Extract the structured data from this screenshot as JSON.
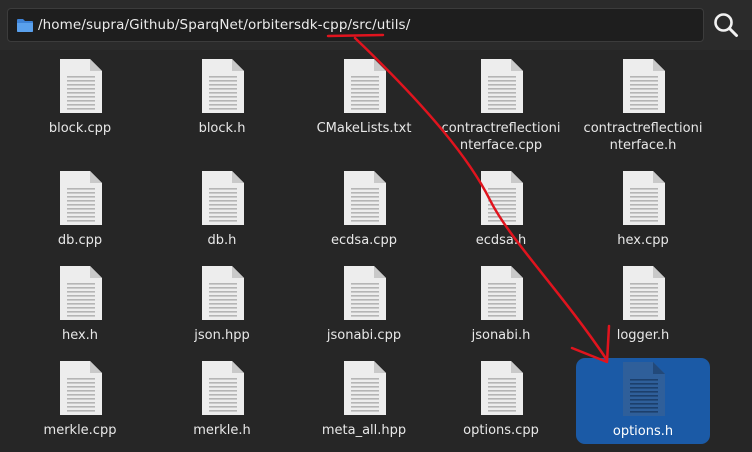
{
  "pathbar": {
    "path": "/home/supra/Github/SparqNet/orbitersdk-cpp/src/utils/",
    "folder_icon": "folder-icon",
    "search_icon": "search-icon"
  },
  "files": [
    {
      "name": "block.cpp"
    },
    {
      "name": "block.h"
    },
    {
      "name": "CMakeLists.txt"
    },
    {
      "name": "contractreflectioninterface.cpp"
    },
    {
      "name": "contractreflectioninterface.h"
    },
    {
      "name": "db.cpp"
    },
    {
      "name": "db.h"
    },
    {
      "name": "ecdsa.cpp"
    },
    {
      "name": "ecdsa.h"
    },
    {
      "name": "hex.cpp"
    },
    {
      "name": "hex.h"
    },
    {
      "name": "json.hpp"
    },
    {
      "name": "jsonabi.cpp"
    },
    {
      "name": "jsonabi.h"
    },
    {
      "name": "logger.h"
    },
    {
      "name": "merkle.cpp"
    },
    {
      "name": "merkle.h"
    },
    {
      "name": "meta_all.hpp"
    },
    {
      "name": "options.cpp"
    },
    {
      "name": "options.h",
      "selected": true
    }
  ],
  "colors": {
    "background": "#262626",
    "selection": "#1b5aa6",
    "annotation": "#e0141e",
    "folder_icon": "#4a90d9"
  }
}
